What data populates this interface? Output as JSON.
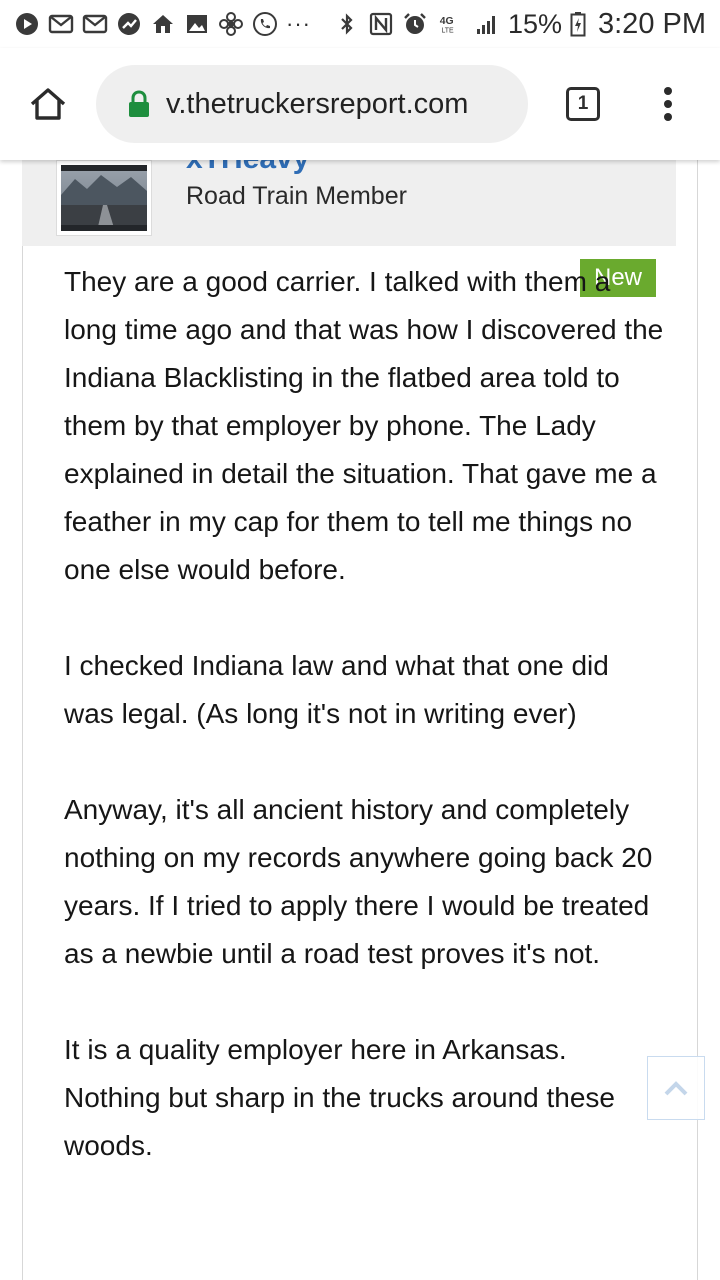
{
  "status_bar": {
    "battery": "15%",
    "time": "3:20 PM",
    "network": "4G LTE",
    "overflow": "···",
    "left_icons": [
      "record-icon",
      "gmail-icon",
      "gmail-icon",
      "trending-icon",
      "home-icon",
      "image-icon",
      "fan-icon",
      "phone-icon"
    ],
    "right_icons": [
      "bluetooth-icon",
      "nfc-icon",
      "alarm-icon",
      "signal-icon",
      "battery-icon"
    ]
  },
  "browser": {
    "url": "v.thetruckersreport.com",
    "tab_count": "1",
    "lock_color": "#1e8e3e"
  },
  "post": {
    "username": "xTHeavy",
    "user_title": "Road Train Member",
    "badge": "New",
    "paragraphs": [
      "They are a good carrier. I talked with them a long time ago and that was how I discovered the Indiana Blacklisting in the flatbed area told to them by that employer by phone. The Lady explained in detail the situation. That gave me a feather in my cap for them to tell me things no one else would before.",
      "I checked Indiana law and what that one did was legal. (As long it's not in writing ever)",
      "Anyway, it's all ancient history and completely nothing on my records anywhere going back 20 years. If I tried to apply there I would be treated as a newbie until a road test proves it's not.",
      "It is a quality employer here in Arkansas. Nothing but sharp in the trucks around these woods."
    ]
  },
  "colors": {
    "username": "#2f6db5",
    "badge_bg": "#6aaa2e",
    "header_bg": "#efefef"
  }
}
